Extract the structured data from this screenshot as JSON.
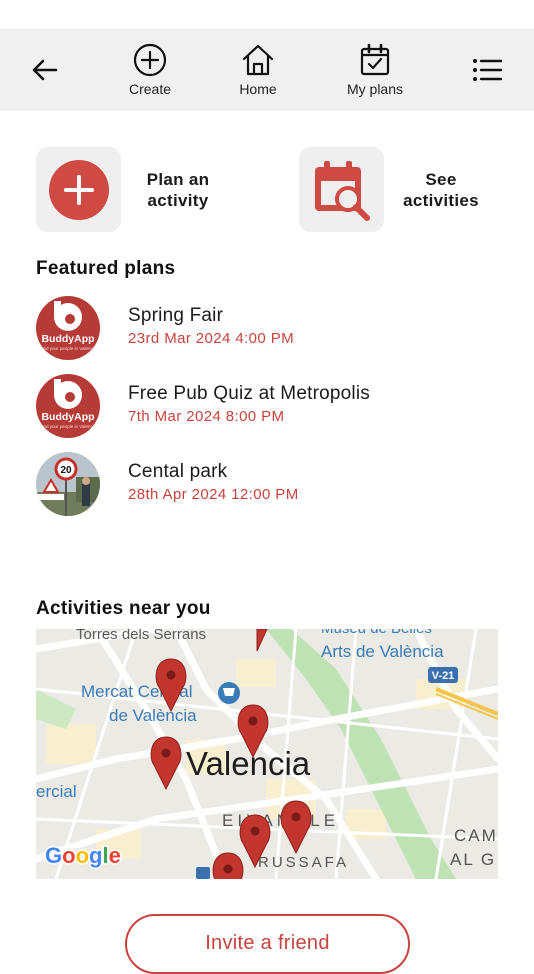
{
  "nav": {
    "create_label": "Create",
    "home_label": "Home",
    "myplans_label": "My plans"
  },
  "quick_actions": {
    "plan_label_line1": "Plan an",
    "plan_label_line2": "activity",
    "see_label_line1": "See",
    "see_label_line2": "activities"
  },
  "featured": {
    "title": "Featured plans",
    "items": [
      {
        "name": "Spring Fair",
        "date": "23rd Mar 2024 4:00 PM",
        "avatar": "buddyapp-logo"
      },
      {
        "name": "Free Pub Quiz at Metropolis",
        "date": "7th Mar 2024 8:00 PM",
        "avatar": "buddyapp-logo"
      },
      {
        "name": "Cental park",
        "date": "28th Apr 2024 12:00 PM",
        "avatar": "road-sign-photo"
      }
    ]
  },
  "logo_text": {
    "brand": "BuddyApp",
    "tagline": "Find your people in Valencia"
  },
  "nearby": {
    "title": "Activities near you",
    "map": {
      "city": "Valencia",
      "labels": [
        "Torres dels Serrans",
        "Museu de Belles Arts de València",
        "Mercat Central de València",
        "EIXAMPLE",
        "RUSSAFA",
        "CAM AL G",
        "V-21",
        "ercial"
      ],
      "provider": "Google"
    }
  },
  "invite_label": "Invite a friend",
  "colors": {
    "accent": "#c9433e",
    "topbar_bg": "#f0f0f0",
    "tile_bg": "#efefef"
  }
}
